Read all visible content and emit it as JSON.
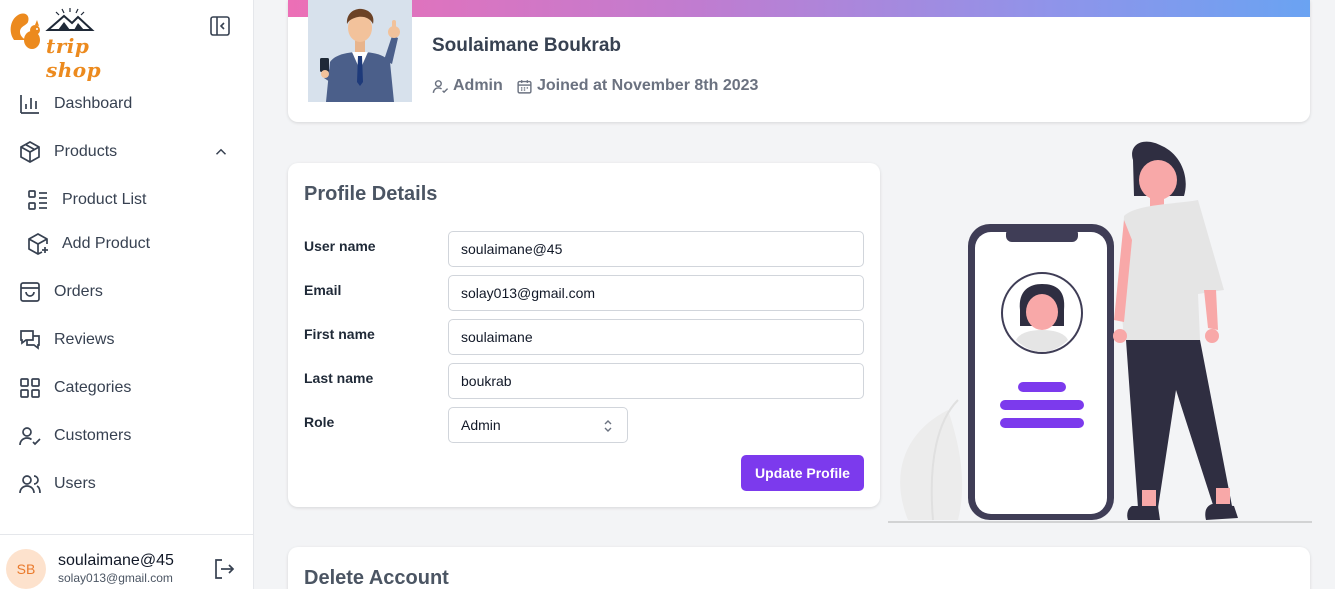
{
  "brand": {
    "logo_text": "trip shop"
  },
  "sidebar": {
    "items": [
      {
        "label": "Dashboard"
      },
      {
        "label": "Products"
      },
      {
        "label": "Product List"
      },
      {
        "label": "Add Product"
      },
      {
        "label": "Orders"
      },
      {
        "label": "Reviews"
      },
      {
        "label": "Categories"
      },
      {
        "label": "Customers"
      },
      {
        "label": "Users"
      }
    ],
    "user": {
      "initials": "SB",
      "name": "soulaimane@45",
      "email": "solay013@gmail.com"
    }
  },
  "profile": {
    "name": "Soulaimane Boukrab",
    "role": "Admin",
    "joined": "Joined at November 8th 2023"
  },
  "details": {
    "title": "Profile Details",
    "fields": [
      {
        "label": "User name",
        "value": "soulaimane@45"
      },
      {
        "label": "Email",
        "value": "solay013@gmail.com"
      },
      {
        "label": "First name",
        "value": "soulaimane"
      },
      {
        "label": "Last name",
        "value": "boukrab"
      }
    ],
    "role_label": "Role",
    "role_value": "Admin",
    "update_label": "Update Profile"
  },
  "delete": {
    "title": "Delete Account"
  },
  "colors": {
    "accent": "#7c3aed",
    "brand": "#ec8a1e"
  }
}
